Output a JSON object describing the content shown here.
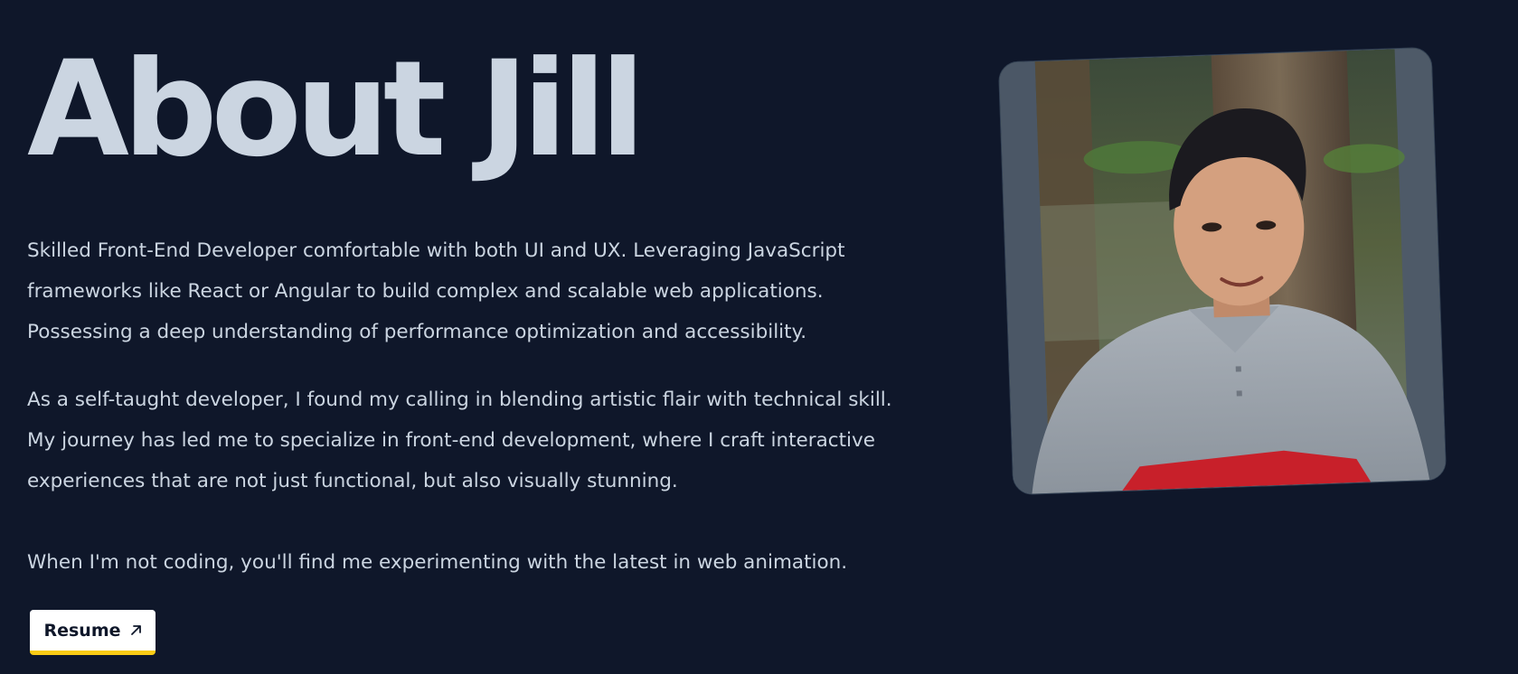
{
  "page": {
    "title": "About Jill",
    "paragraphs": [
      "Skilled Front-End Developer comfortable with both UI and UX. Leveraging JavaScript frameworks like React or Angular to build complex and scalable web applications. Possessing a deep understanding of performance optimization and accessibility.",
      "As a self-taught developer, I found my calling in blending artistic flair with technical skill. My journey has led me to specialize in front-end development, where I craft interactive experiences that are not just functional, but also visually stunning.",
      "When I'm not coding, you'll find me experimenting with the latest in web animation."
    ],
    "resume_label": "Resume"
  },
  "icons": {
    "resume": "arrow-up-right-icon"
  },
  "colors": {
    "background": "#0f172a",
    "text": "#cbd5e1",
    "button_bg": "#ffffff",
    "button_accent": "#facc15"
  }
}
